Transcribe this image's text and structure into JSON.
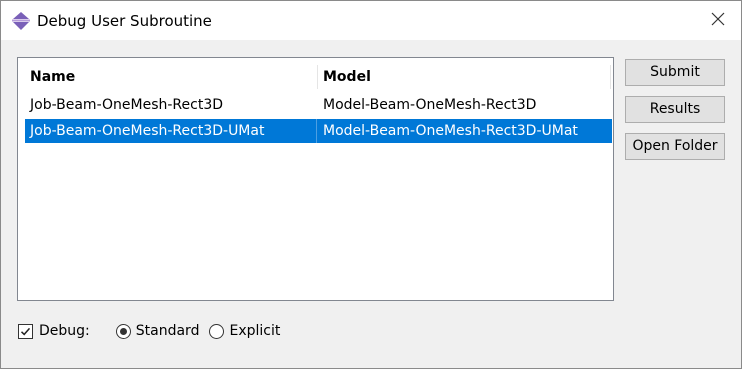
{
  "window": {
    "title": "Debug User Subroutine"
  },
  "table": {
    "columns": [
      "Name",
      "Model"
    ],
    "rows": [
      {
        "name": "Job-Beam-OneMesh-Rect3D",
        "model": "Model-Beam-OneMesh-Rect3D",
        "selected": false
      },
      {
        "name": "Job-Beam-OneMesh-Rect3D-UMat",
        "model": "Model-Beam-OneMesh-Rect3D-UMat",
        "selected": true
      }
    ]
  },
  "buttons": {
    "submit": "Submit",
    "results": "Results",
    "open_folder": "Open Folder"
  },
  "options": {
    "debug_label": "Debug:",
    "debug_checked": true,
    "standard_label": "Standard",
    "explicit_label": "Explicit",
    "selected_mode": "Standard"
  },
  "colors": {
    "selection": "#0078d7",
    "app_icon": "#6a4fa3"
  }
}
